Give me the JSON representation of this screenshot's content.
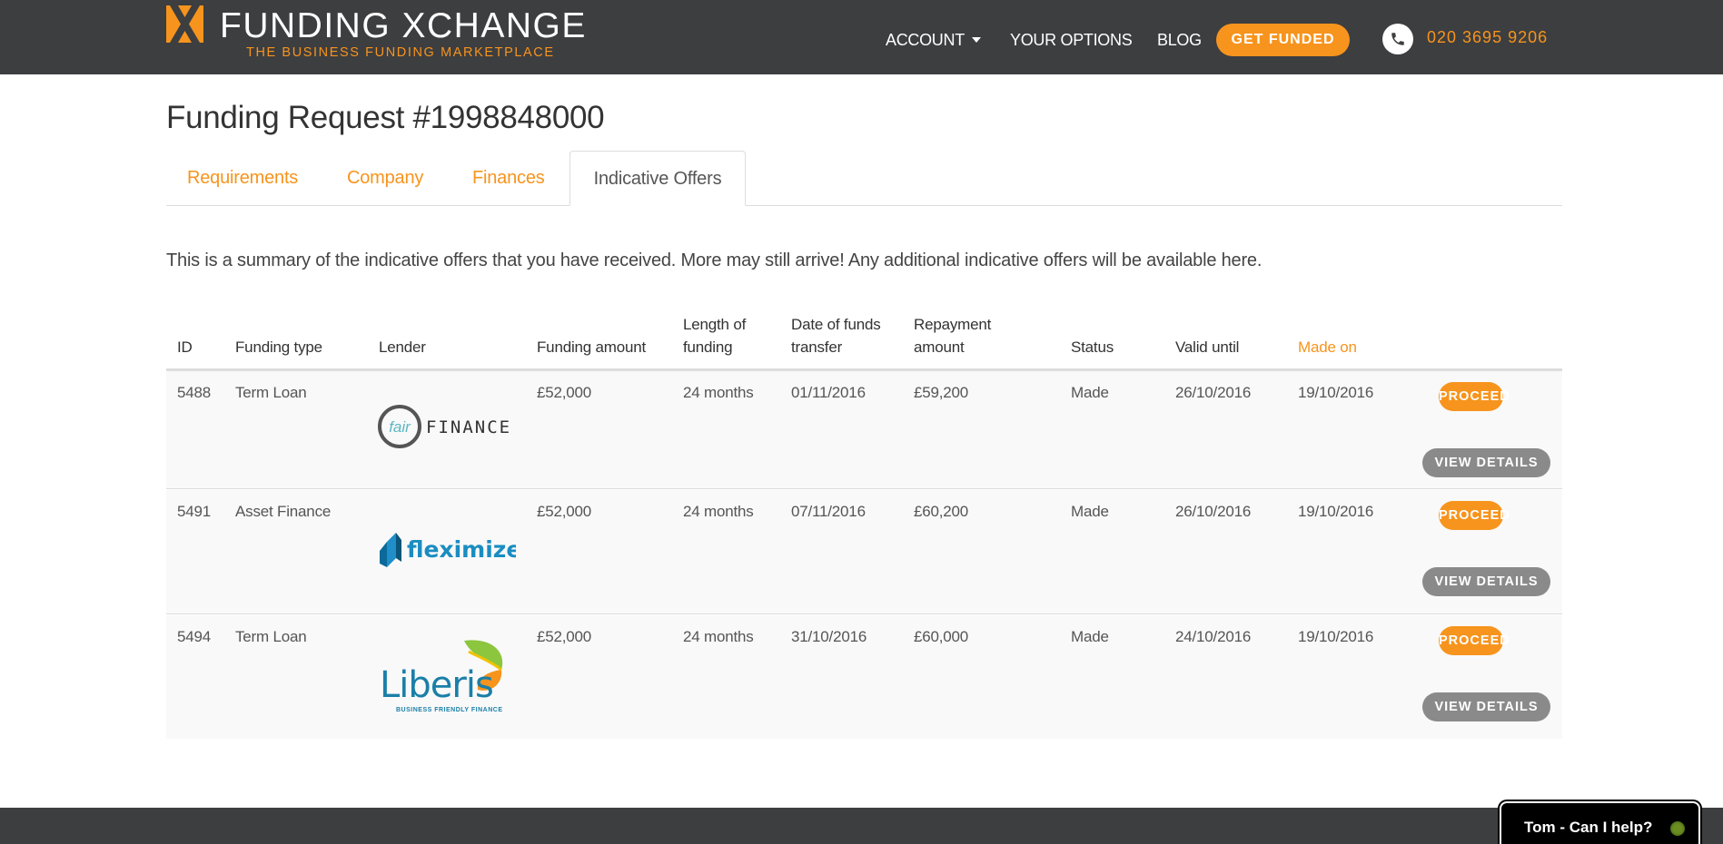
{
  "brand": {
    "name": "FUNDING XCHANGE",
    "tagline": "THE BUSINESS FUNDING MARKETPLACE",
    "accent_color": "#f7941d",
    "header_bg": "#3d3e40"
  },
  "nav": {
    "account": "ACCOUNT",
    "options": "YOUR OPTIONS",
    "blog": "BLOG",
    "get_funded": "GET FUNDED",
    "phone": "020 3695 9206"
  },
  "page": {
    "title": "Funding Request #1998848000",
    "tabs": [
      {
        "label": "Requirements"
      },
      {
        "label": "Company"
      },
      {
        "label": "Finances"
      },
      {
        "label": "Indicative Offers",
        "active": true
      }
    ],
    "summary": "This is a summary of the indicative offers that you have received. More may still arrive! Any additional indicative offers will be available here."
  },
  "table": {
    "headers": {
      "id": "ID",
      "funding_type": "Funding type",
      "lender": "Lender",
      "funding_amount": "Funding amount",
      "length_1": "Length of",
      "length_2": "funding",
      "date_1": "Date of funds",
      "date_2": "transfer",
      "repay_1": "Repayment",
      "repay_2": "amount",
      "status": "Status",
      "valid_until": "Valid until",
      "made_on": "Made on"
    },
    "rows": [
      {
        "id": "5488",
        "funding_type": "Term Loan",
        "lender": "fair FINANCE",
        "lender_logo_word": "fair",
        "lender_logo_rest": "FINANCE",
        "funding_amount": "£52,000",
        "length": "24 months",
        "date": "01/11/2016",
        "repayment": "£59,200",
        "status": "Made",
        "valid_until": "26/10/2016",
        "made_on": "19/10/2016"
      },
      {
        "id": "5491",
        "funding_type": "Asset Finance",
        "lender": "fleximize",
        "funding_amount": "£52,000",
        "length": "24 months",
        "date": "07/11/2016",
        "repayment": "£60,200",
        "status": "Made",
        "valid_until": "26/10/2016",
        "made_on": "19/10/2016"
      },
      {
        "id": "5494",
        "funding_type": "Term Loan",
        "lender": "Liberis",
        "lender_tagline": "BUSINESS FRIENDLY FINANCE",
        "funding_amount": "£52,000",
        "length": "24 months",
        "date": "31/10/2016",
        "repayment": "£60,000",
        "status": "Made",
        "valid_until": "24/10/2016",
        "made_on": "19/10/2016"
      }
    ],
    "proceed_label": "PROCEED",
    "details_label": "VIEW DETAILS"
  },
  "chat": {
    "label": "Tom - Can I help?",
    "status_color": "#6b8e23"
  }
}
